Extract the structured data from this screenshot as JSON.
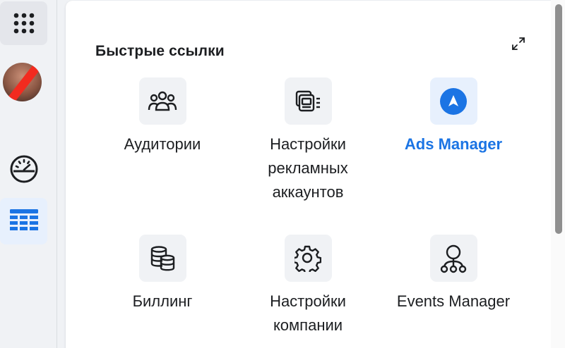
{
  "sidebar": {
    "apps_icon": "apps-grid-icon",
    "avatar_icon": "user-avatar",
    "gauge_icon": "dashboard-gauge-icon",
    "table_icon": "table-grid-icon"
  },
  "quick_links": {
    "title": "Быстрые ссылки",
    "expand_icon": "expand-icon",
    "items": [
      {
        "label": "Аудитории",
        "icon": "audiences-icon"
      },
      {
        "label": "Настройки рекламных аккаунтов",
        "icon": "ad-account-settings-icon"
      },
      {
        "label": "Ads Manager",
        "icon": "ads-manager-icon"
      },
      {
        "label": "Биллинг",
        "icon": "billing-icon"
      },
      {
        "label": "Настройки компании",
        "icon": "business-settings-icon"
      },
      {
        "label": "Events Manager",
        "icon": "events-manager-icon"
      }
    ]
  },
  "colors": {
    "accent": "#1b74e4",
    "active_bg": "#e7f0fd",
    "tile_bg": "#f0f2f5",
    "text": "#1c1e21"
  }
}
